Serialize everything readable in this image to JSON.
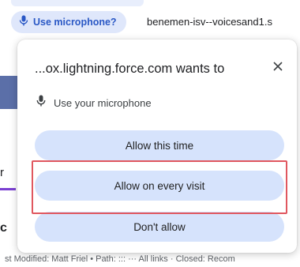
{
  "address_bar": {
    "chip_label": "Use microphone?",
    "url": "benemen-isv--voicesand1.s"
  },
  "background_page": {
    "fragment_r": "r",
    "fragment_c": "c",
    "bottom_text": "st Modified: Matt Friel • Path: ::: ··· All links · Closed: Recom"
  },
  "permission_popup": {
    "title": "...ox.lightning.force.com wants to",
    "permission_label": "Use your microphone",
    "buttons": {
      "allow_once": "Allow this time",
      "allow_always": "Allow on every visit",
      "deny": "Don't allow"
    },
    "highlighted_button": "allow_always"
  },
  "colors": {
    "chip_bg": "#dfe7fb",
    "chip_text": "#2a58c5",
    "button_bg": "#d6e3fc",
    "highlight": "#e0575f"
  },
  "icons": {
    "chip": "microphone-icon",
    "permission": "microphone-icon",
    "close": "close-icon"
  }
}
